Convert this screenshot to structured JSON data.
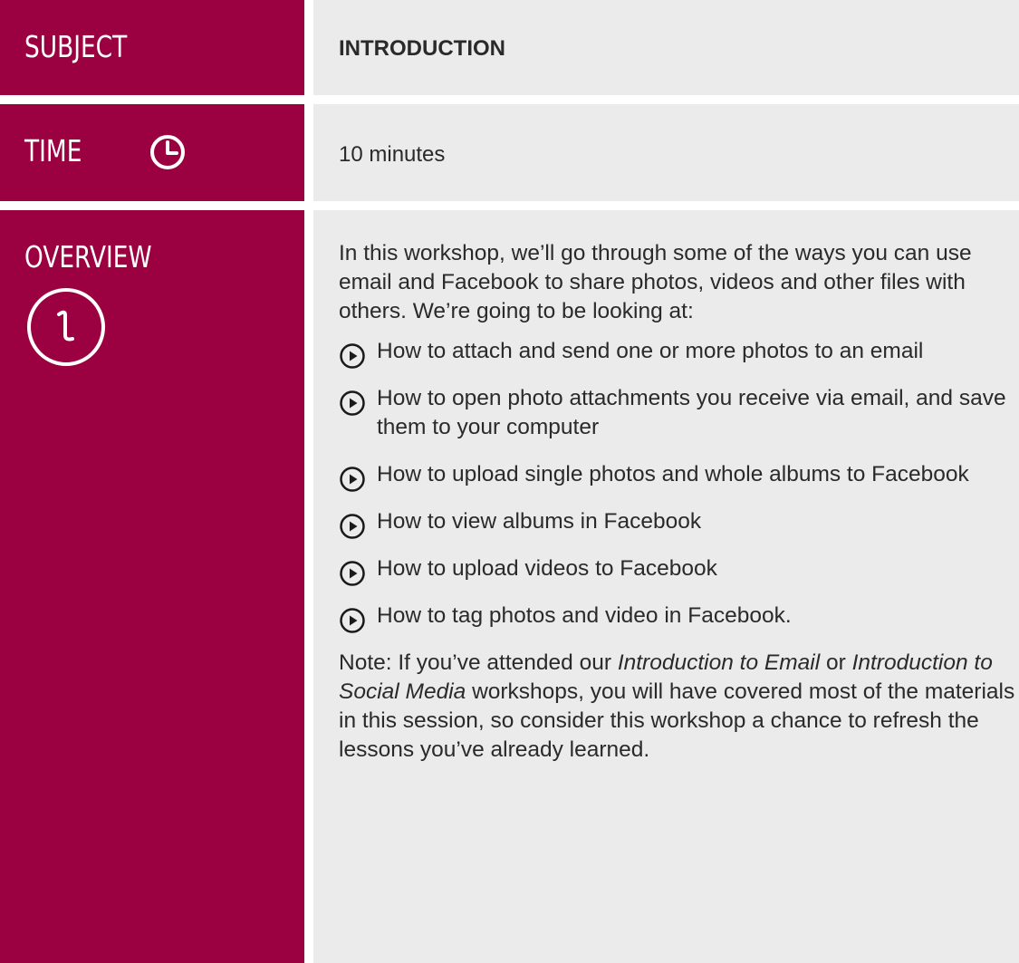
{
  "subject": {
    "label": "SUBJECT",
    "value": "INTRODUCTION"
  },
  "time": {
    "label": "TIME",
    "value": "10 minutes",
    "icon": "clock-icon"
  },
  "overview": {
    "label": "OVERVIEW",
    "icon": "number-one-circle-icon",
    "intro": "In this workshop, we’ll go through some of the ways you can use email and Facebook to share photos, videos and other files with others. We’re going to be looking at:",
    "bullets": [
      "How to attach and send one or more photos to an email",
      "How to open photo attachments you receive via email, and save them to your computer",
      "How to upload single photos and whole albums to Facebook",
      "How to view albums in Facebook",
      "How to upload videos to Facebook",
      "How to tag photos and video in Facebook."
    ],
    "note": {
      "part1": "Note: If you’ve attended our ",
      "course1": "Introduction to Email",
      "part2": " or ",
      "course2": "Introduction to Social Media",
      "part3": " workshops, you will have covered most of the materials in this session, so consider this workshop a chance to refresh the lessons you’ve already learned."
    }
  },
  "colors": {
    "accent": "#9b0040",
    "panel": "#ebebeb",
    "text": "#2a2a2a"
  }
}
